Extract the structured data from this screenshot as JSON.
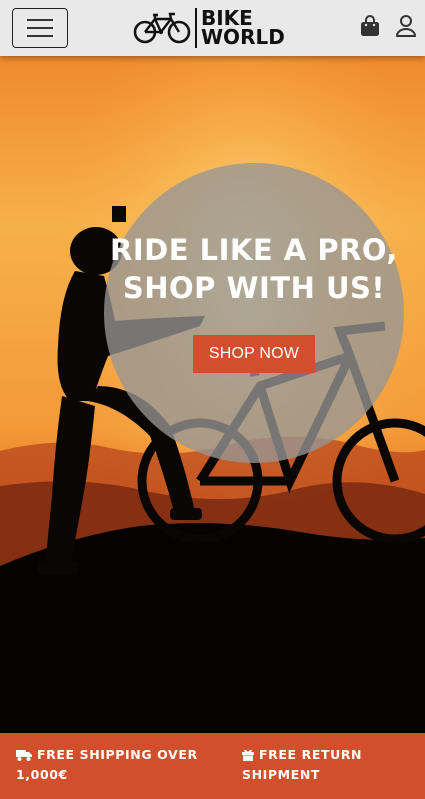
{
  "header": {
    "brand_line1": "BIKE",
    "brand_line2": "WORLD",
    "menu_icon": "hamburger-menu-icon",
    "cart_icon": "shopping-bag-icon",
    "account_icon": "user-icon"
  },
  "hero": {
    "title_line1": "RIDE LIKE A PRO,",
    "title_line2": "SHOP WITH US!",
    "cta_label": "SHOP NOW"
  },
  "promo_bar": {
    "shipping_text": "FREE SHIPPING OVER 1,000€",
    "shipping_icon": "truck-icon",
    "return_text": "FREE RETURN SHIPMENT",
    "return_icon": "gift-icon"
  },
  "colors": {
    "accent": "#d14f2c",
    "header_bg": "#e9e9e9",
    "sky_top": "#f6b04a",
    "sky_bottom": "#d55a1c"
  }
}
